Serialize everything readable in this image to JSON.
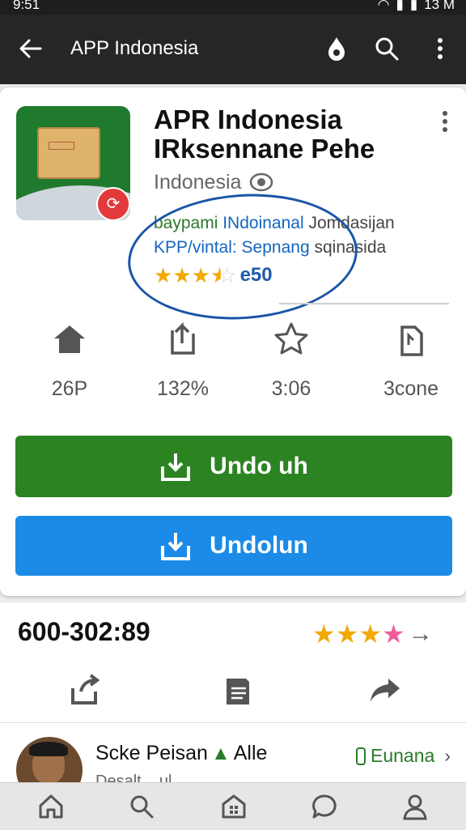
{
  "status": {
    "time": "9:51",
    "battery": "13 M"
  },
  "appbar": {
    "title": "APP Indonesia"
  },
  "app": {
    "title": "APR Indonesia IRksennane Pehe",
    "developer": "Indonesia",
    "desc_line1_a": "baypami ",
    "desc_line1_b": "INdoinanal",
    "desc_line1_c": " Jomdasijan",
    "desc_line2_a": "KPP/vintal: Sepnang",
    "desc_line2_b": " sqinasida",
    "rating_value": 3.5,
    "rating_count": "e50"
  },
  "stats": [
    {
      "icon": "home-icon",
      "value": "26P"
    },
    {
      "icon": "share-doc-icon",
      "value": "132%"
    },
    {
      "icon": "star-outline-icon",
      "value": "3:06"
    },
    {
      "icon": "copy-doc-icon",
      "value": "3cone"
    }
  ],
  "buttons": {
    "primary": "Undo uh",
    "secondary": "Undolun"
  },
  "review_section": {
    "phone": "600-302:89",
    "stars_yellow": 3,
    "stars_pink": 1,
    "arrow": "→"
  },
  "reviewer": {
    "name_a": "Scke Peisan",
    "name_b": "Alle",
    "subtext": "Desalt ...ul",
    "tag": "Eunana",
    "chevron": "›"
  },
  "colors": {
    "green": "#2b8322",
    "blue": "#1b8be7",
    "appbar": "#262626",
    "star": "#f2a900",
    "pink_star": "#ec5f9a"
  }
}
